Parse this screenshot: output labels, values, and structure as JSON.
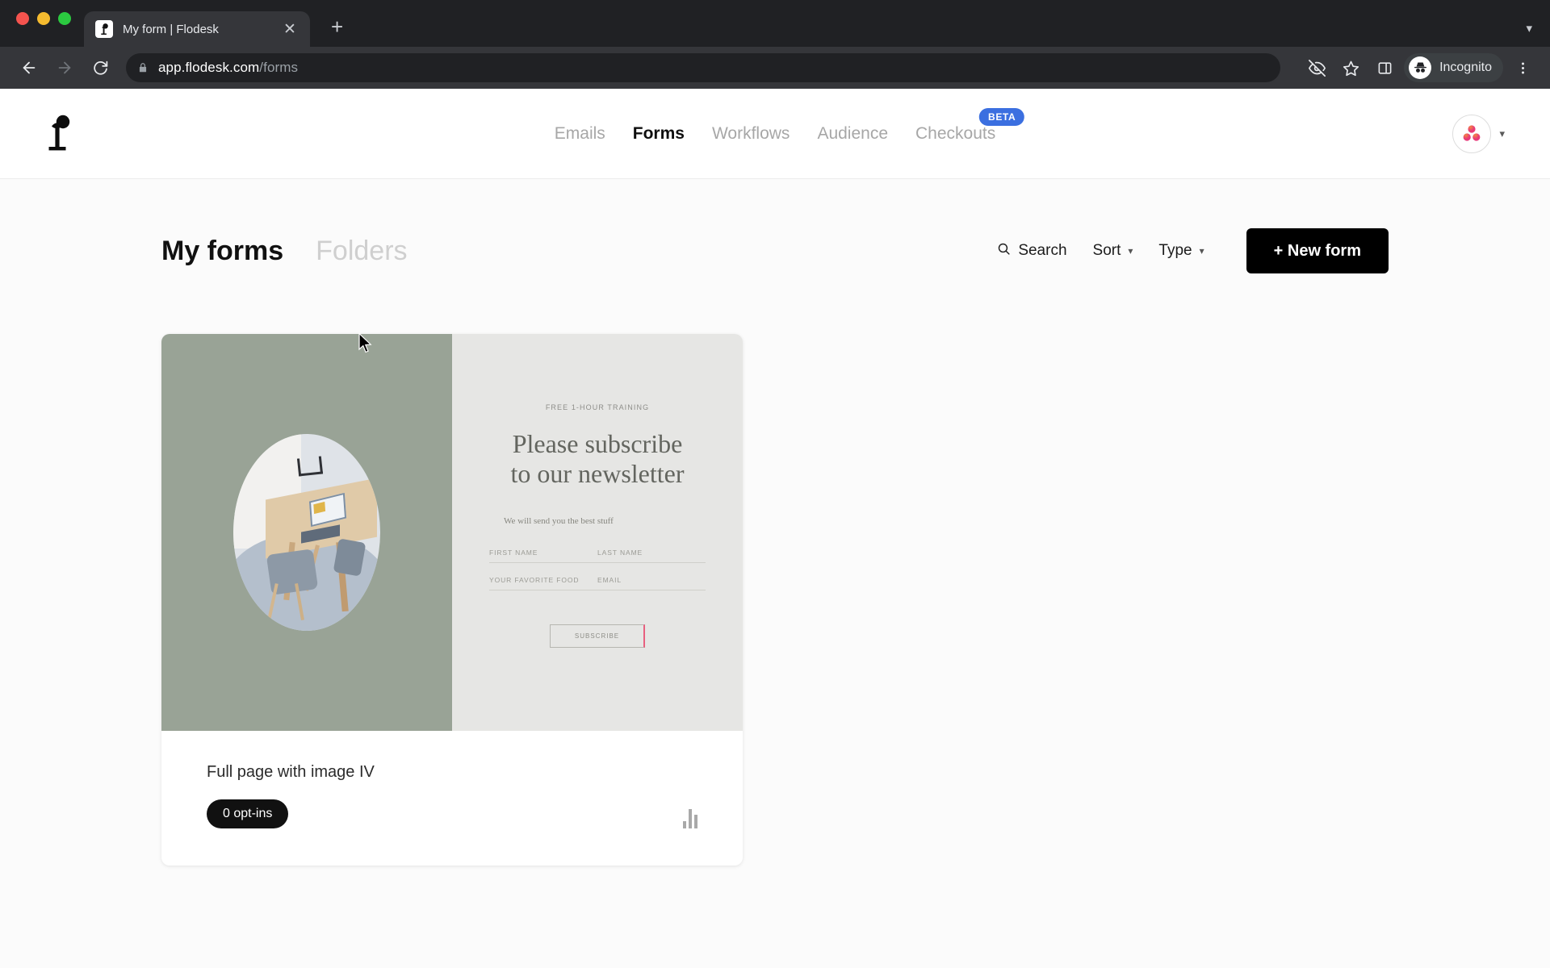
{
  "browser": {
    "tab": {
      "title": "My form | Flodesk",
      "favicon_icon": "flodesk-favicon",
      "close_icon": "close-icon"
    },
    "new_tab_icon": "plus-icon",
    "back_icon": "back-arrow-icon",
    "forward_icon": "forward-arrow-icon",
    "reload_icon": "reload-icon",
    "lock_icon": "lock-icon",
    "url_host": "app.flodesk.com",
    "url_path": "/forms",
    "right_icons": [
      "eye-slash-icon",
      "star-icon",
      "side-panel-icon"
    ],
    "incognito_label": "Incognito",
    "incognito_icon": "incognito-hat-icon",
    "menu_icon": "three-dot-menu-icon",
    "tab_list_icon": "tab-list-chevron-icon"
  },
  "appbar": {
    "logo_icon": "flodesk-logo",
    "nav": [
      {
        "label": "Emails",
        "active": false
      },
      {
        "label": "Forms",
        "active": true
      },
      {
        "label": "Workflows",
        "active": false
      },
      {
        "label": "Audience",
        "active": false
      },
      {
        "label": "Checkouts",
        "active": false,
        "badge": "BETA"
      }
    ],
    "avatar_icon": "avatar-three-dots",
    "account_chevron_icon": "chevron-down-icon"
  },
  "pagehead": {
    "tab_my_forms": "My forms",
    "tab_folders": "Folders",
    "search_label": "Search",
    "search_icon": "search-icon",
    "sort_label": "Sort",
    "sort_chevron_icon": "chevron-down-icon",
    "type_label": "Type",
    "type_chevron_icon": "chevron-down-icon",
    "new_form_label": "+ New form"
  },
  "form_card": {
    "preview": {
      "image_icon": "desk-photo",
      "eyebrow": "FREE 1-HOUR TRAINING",
      "headline": "Please subscribe\nto our newsletter",
      "subtext": "We will send you the best stuff",
      "fields": [
        [
          "FIRST NAME",
          "LAST NAME"
        ],
        [
          "YOUR FAVORITE FOOD",
          "EMAIL"
        ]
      ],
      "button_label": "SUBSCRIBE"
    },
    "title": "Full page with image IV",
    "optins_badge": "0 opt-ins",
    "analytics_icon": "bar-chart-icon"
  },
  "colors": {
    "accent_beta": "#3b6fe0",
    "card_image_bg": "#99a396",
    "card_form_bg": "#e6e6e4",
    "button_primary": "#000000",
    "subscribe_accent": "#e8607f"
  },
  "cursor_icon": "mouse-pointer"
}
